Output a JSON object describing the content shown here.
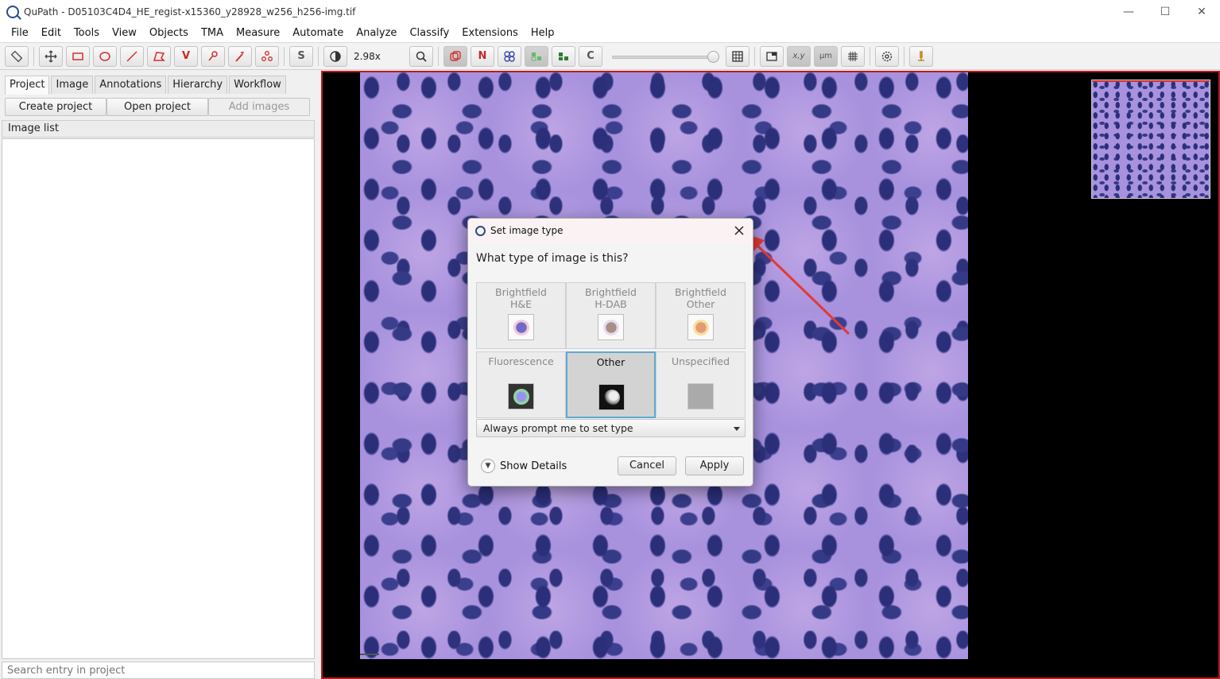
{
  "window": {
    "title": "QuPath - D05103C4D4_HE_regist-x15360_y28928_w256_h256-img.tif",
    "controls": [
      "—",
      "☐",
      "✕"
    ]
  },
  "menu": [
    "File",
    "Edit",
    "Tools",
    "View",
    "Objects",
    "TMA",
    "Measure",
    "Automate",
    "Analyze",
    "Classify",
    "Extensions",
    "Help"
  ],
  "toolbar": {
    "zoom": "2.98x",
    "labels": {
      "selection": "S",
      "points": "N",
      "c": "C",
      "xy": "x,y",
      "um": "μm",
      "v": "V"
    }
  },
  "left": {
    "tabs": [
      "Project",
      "Image",
      "Annotations",
      "Hierarchy",
      "Workflow"
    ],
    "buttons": [
      "Create project",
      "Open project",
      "Add images"
    ],
    "image_list_header": "Image list",
    "search_placeholder": "Search entry in project"
  },
  "dialog": {
    "title": "Set image type",
    "question": "What type of image is this?",
    "types": [
      {
        "line1": "Brightfield",
        "line2": "H&E",
        "selected": false,
        "color": "#6f6ac8"
      },
      {
        "line1": "Brightfield",
        "line2": "H-DAB",
        "selected": false,
        "color": "#a88f86"
      },
      {
        "line1": "Brightfield",
        "line2": "Other",
        "selected": false,
        "color": "#e39c72"
      },
      {
        "line1": "Fluorescence",
        "line2": "",
        "selected": false,
        "color": "#8fd6a0"
      },
      {
        "line1": "Other",
        "line2": "",
        "selected": true,
        "color": "#111111"
      },
      {
        "line1": "Unspecified",
        "line2": "",
        "selected": false,
        "color": "#aaaaaa"
      }
    ],
    "prompt_select": "Always prompt me to set type",
    "show_details": "Show Details",
    "cancel": "Cancel",
    "apply": "Apply"
  },
  "colors": {
    "viewer_border": "#b71c1c",
    "tissue": "#a892de",
    "nuclei": "#2b2f7a",
    "selected_border": "#5fa8d3",
    "arrow": "#e53935"
  }
}
